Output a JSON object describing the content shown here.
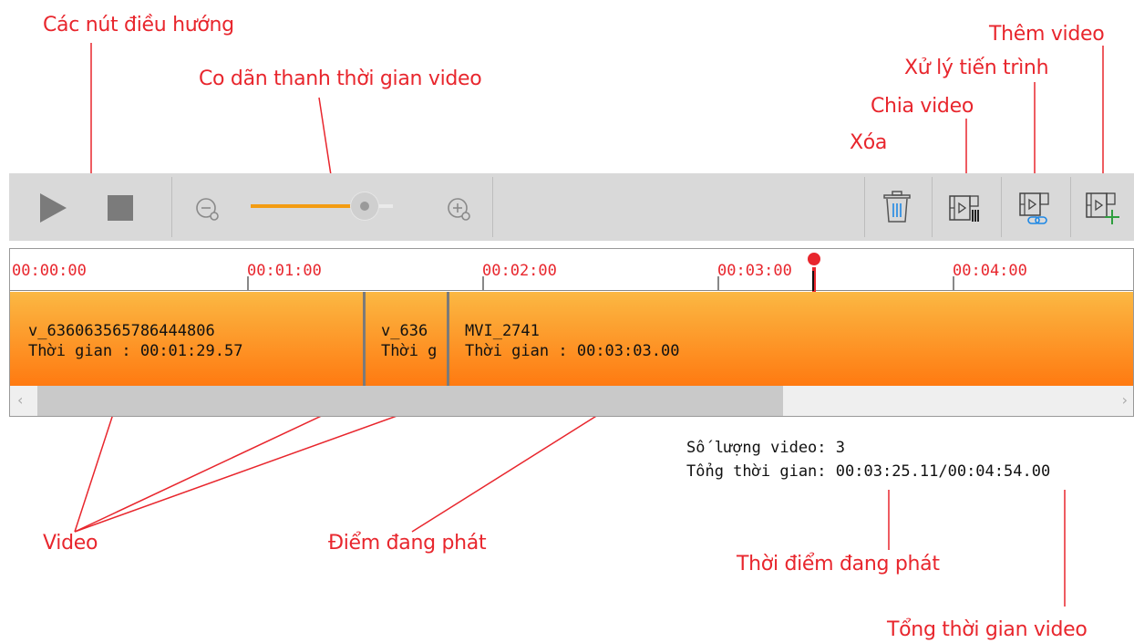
{
  "annotations": {
    "nav_buttons": "Các nút điều hướng",
    "zoom": "Co dãn thanh thời gian video",
    "add_video": "Thêm video",
    "process": "Xử lý tiến trình",
    "split": "Chia video",
    "delete": "Xóa",
    "video": "Video",
    "play_point": "Điểm đang phát",
    "current_time": "Thời điểm đang phát",
    "total_time": "Tổng thời gian video"
  },
  "toolbar": {
    "icons": [
      "play-icon",
      "stop-icon",
      "zoom-out-icon",
      "zoom-slider",
      "zoom-in-icon",
      "trash-icon",
      "split-video-icon",
      "process-icon",
      "add-video-icon"
    ],
    "zoom_level": 0.8,
    "colors": {
      "background": "#d9d9d9",
      "slider": "#f39c12"
    }
  },
  "ruler": {
    "ticks": [
      "00:00:00",
      "00:01:00",
      "00:02:00",
      "00:03:00",
      "00:04:00"
    ],
    "playhead_seconds": 205.11
  },
  "clips": [
    {
      "name": "v_636063565786444806",
      "duration_label": "Thời gian :",
      "duration": "00:01:29.57"
    },
    {
      "name": "v_636",
      "duration_label": "Thời g",
      "duration": ""
    },
    {
      "name": "MVI_2741",
      "duration_label": "Thời gian :",
      "duration": "00:03:03.00"
    }
  ],
  "status": {
    "count_label": "Số lượng video:",
    "count": "3",
    "total_label": "Tổng thời gian:",
    "total": "00:03:25.11/00:04:54.00"
  },
  "colors": {
    "accent": "#e8262d",
    "clip_top": "#fbb843",
    "clip_bottom": "#ff7a11"
  }
}
